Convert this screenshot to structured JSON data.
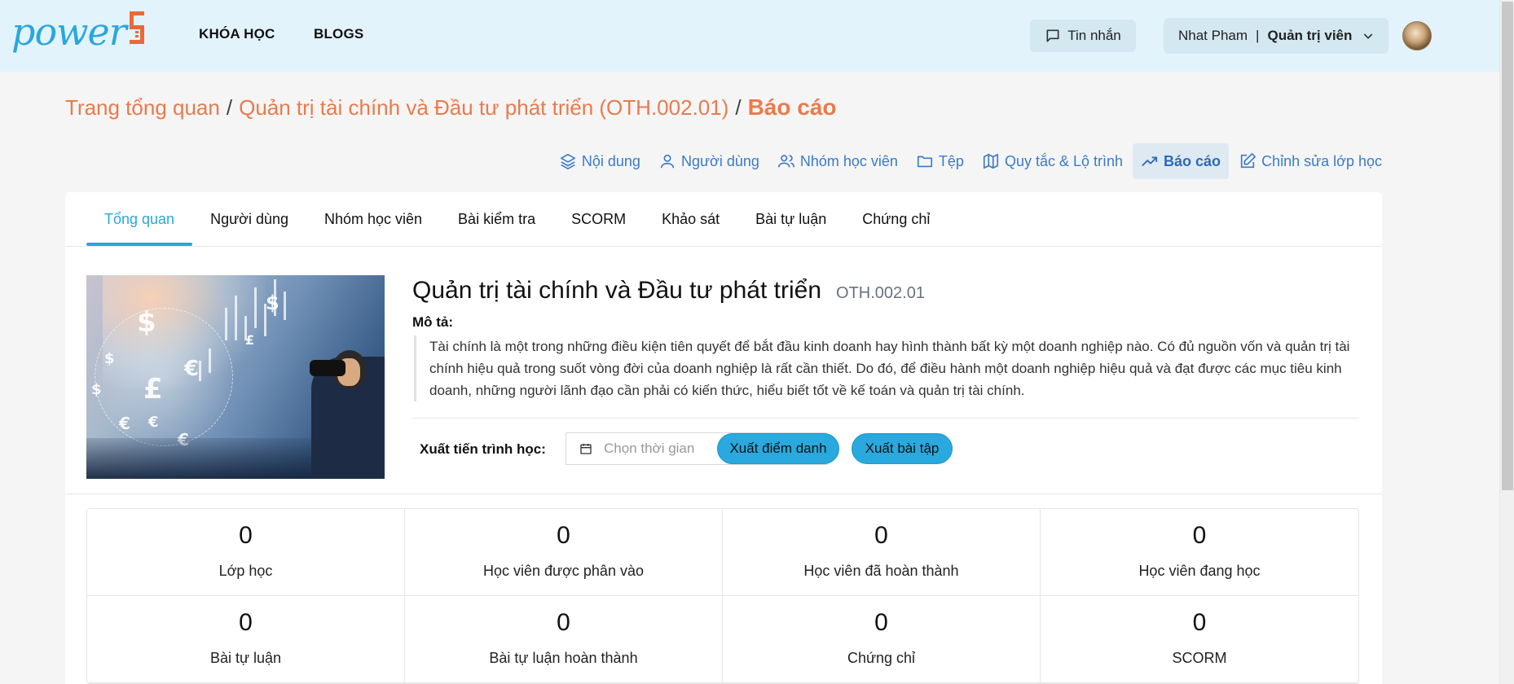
{
  "header": {
    "logo_text": "power",
    "nav": [
      {
        "label": "KHÓA HỌC"
      },
      {
        "label": "BLOGS"
      }
    ],
    "messages_label": "Tin nhắn",
    "user_name": "Nhat Pham",
    "user_separator": "|",
    "user_role": "Quản trị viên"
  },
  "breadcrumb": {
    "home": "Trang tổng quan",
    "course": "Quản trị tài chính và Đầu tư phát triển (OTH.002.01)",
    "current": "Báo cáo",
    "separator": "/"
  },
  "course_nav": [
    {
      "label": "Nội dung",
      "icon": "layers-icon"
    },
    {
      "label": "Người dùng",
      "icon": "user-icon"
    },
    {
      "label": "Nhóm học viên",
      "icon": "users-icon"
    },
    {
      "label": "Tệp",
      "icon": "folder-icon"
    },
    {
      "label": "Quy tắc & Lộ trình",
      "icon": "map-icon"
    },
    {
      "label": "Báo cáo",
      "icon": "trending-up-icon",
      "active": true
    },
    {
      "label": "Chỉnh sửa lớp học",
      "icon": "edit-icon"
    }
  ],
  "tabs": [
    {
      "label": "Tổng quan",
      "active": true
    },
    {
      "label": "Người dùng"
    },
    {
      "label": "Nhóm học viên"
    },
    {
      "label": "Bài kiểm tra"
    },
    {
      "label": "SCORM"
    },
    {
      "label": "Khảo sát"
    },
    {
      "label": "Bài tự luận"
    },
    {
      "label": "Chứng chỉ"
    }
  ],
  "course": {
    "name": "Quản trị tài chính và Đầu tư phát triển",
    "code": "OTH.002.01",
    "description_label": "Mô tả:",
    "description": "Tài chính là một trong những điều kiện tiên quyết để bắt đầu kinh doanh hay hình thành bất kỳ một doanh nghiệp nào. Có đủ nguồn vốn và quản trị tài chính hiệu quả trong suốt vòng đời của doanh nghiệp là rất cần thiết. Do đó, để điều hành một doanh nghiệp hiệu quả và đạt được các mục tiêu kinh doanh, những người lãnh đạo cần phải có kiến thức, hiểu biết tốt về kế toán và quản trị tài chính."
  },
  "export": {
    "label": "Xuất tiến trình học:",
    "date_placeholder": "Chọn thời gian",
    "clear_symbol": "×",
    "attendance_button": "Xuất điểm danh",
    "assignment_button": "Xuất bài tập"
  },
  "stats": [
    {
      "value": "0",
      "label": "Lớp học"
    },
    {
      "value": "0",
      "label": "Học viên được phân vào"
    },
    {
      "value": "0",
      "label": "Học viên đã hoàn thành"
    },
    {
      "value": "0",
      "label": "Học viên đang học"
    },
    {
      "value": "0",
      "label": "Bài tự luận"
    },
    {
      "value": "0",
      "label": "Bài tự luận hoàn thành"
    },
    {
      "value": "0",
      "label": "Chứng chỉ"
    },
    {
      "value": "0",
      "label": "SCORM"
    }
  ],
  "colors": {
    "accent_orange": "#ea7a4c",
    "accent_blue": "#2aa7dc",
    "link_blue": "#3a7bc8",
    "header_bg": "#e3f3fb"
  }
}
